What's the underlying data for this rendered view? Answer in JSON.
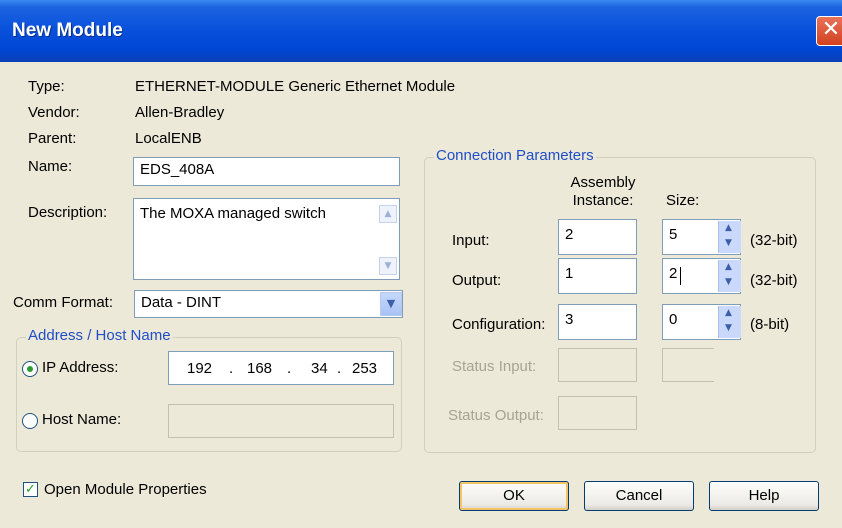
{
  "window": {
    "title": "New Module",
    "close_glyph": "✕"
  },
  "info": {
    "type_label": "Type:",
    "type_value": "ETHERNET-MODULE Generic Ethernet Module",
    "vendor_label": "Vendor:",
    "vendor_value": "Allen-Bradley",
    "parent_label": "Parent:",
    "parent_value": "LocalENB"
  },
  "name": {
    "label": "Name:",
    "value": "EDS_408A"
  },
  "description": {
    "label": "Description:",
    "value": "The MOXA managed switch"
  },
  "comm_format": {
    "label": "Comm Format:",
    "value": "Data - DINT"
  },
  "address": {
    "legend": "Address / Host Name",
    "ip_label": "IP Address:",
    "ip_octets": [
      "192",
      "168",
      "34",
      "253"
    ],
    "ip_selected": true,
    "host_label": "Host Name:",
    "host_value": ""
  },
  "connection": {
    "legend": "Connection Parameters",
    "col_instance": "Assembly\nInstance:",
    "col_size": "Size:",
    "rows": [
      {
        "label": "Input:",
        "instance": "2",
        "size": "5",
        "unit": "(32-bit)"
      },
      {
        "label": "Output:",
        "instance": "1",
        "size": "2",
        "unit": "(32-bit)"
      },
      {
        "label": "Configuration:",
        "instance": "3",
        "size": "0",
        "unit": "(8-bit)"
      }
    ],
    "status_input_label": "Status Input:",
    "status_output_label": "Status Output:"
  },
  "open_props": {
    "label": "Open Module Properties",
    "checked": true
  },
  "buttons": {
    "ok": "OK",
    "cancel": "Cancel",
    "help": "Help"
  },
  "colors": {
    "title_bar": "#0a52dc",
    "legend_text": "#1f4ec9",
    "dialog_bg": "#ece9d8"
  }
}
